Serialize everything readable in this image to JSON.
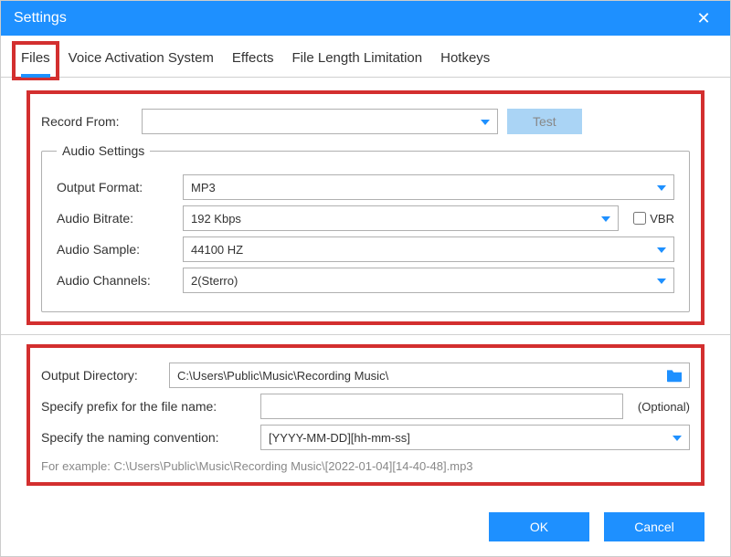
{
  "window": {
    "title": "Settings"
  },
  "tabs": {
    "files": "Files",
    "voice_activation": "Voice Activation System",
    "effects": "Effects",
    "file_length": "File Length Limitation",
    "hotkeys": "Hotkeys"
  },
  "record": {
    "label": "Record  From:",
    "value": "",
    "test_button": "Test"
  },
  "audio_settings": {
    "legend": "Audio Settings",
    "output_format": {
      "label": "Output Format:",
      "value": "MP3"
    },
    "bitrate": {
      "label": "Audio Bitrate:",
      "value": "192 Kbps",
      "vbr_label": "VBR"
    },
    "sample": {
      "label": "Audio Sample:",
      "value": "44100 HZ"
    },
    "channels": {
      "label": "Audio Channels:",
      "value": "2(Sterro)"
    }
  },
  "output": {
    "dir_label": "Output Directory:",
    "dir_value": "C:\\Users\\Public\\Music\\Recording Music\\",
    "prefix_label": "Specify prefix for the file name:",
    "prefix_value": "",
    "optional": "(Optional)",
    "naming_label": "Specify the naming convention:",
    "naming_value": "[YYYY-MM-DD][hh-mm-ss]",
    "example": "For example: C:\\Users\\Public\\Music\\Recording Music\\[2022-01-04][14-40-48].mp3"
  },
  "footer": {
    "ok": "OK",
    "cancel": "Cancel"
  }
}
